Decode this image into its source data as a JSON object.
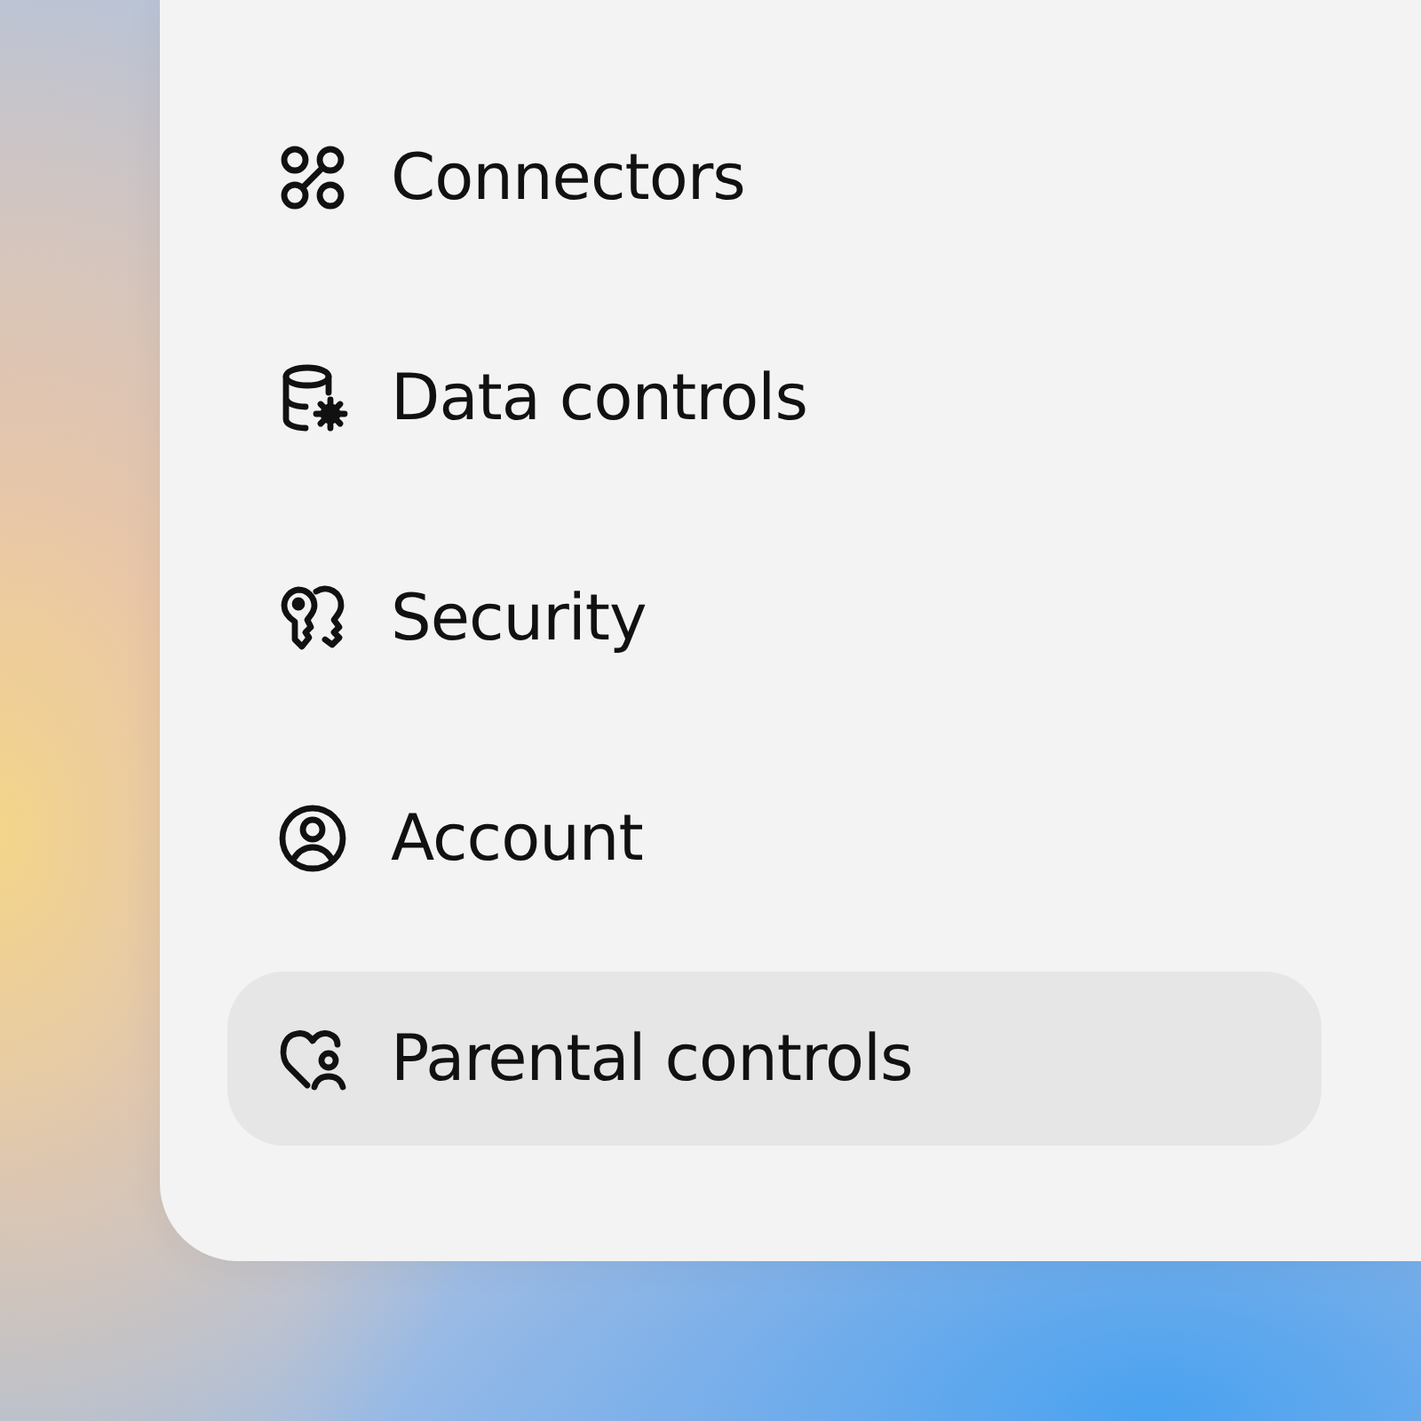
{
  "menu": {
    "items": [
      {
        "label": "Connectors",
        "selected": false
      },
      {
        "label": "Data controls",
        "selected": false
      },
      {
        "label": "Security",
        "selected": false
      },
      {
        "label": "Account",
        "selected": false
      },
      {
        "label": "Parental controls",
        "selected": true
      }
    ]
  }
}
